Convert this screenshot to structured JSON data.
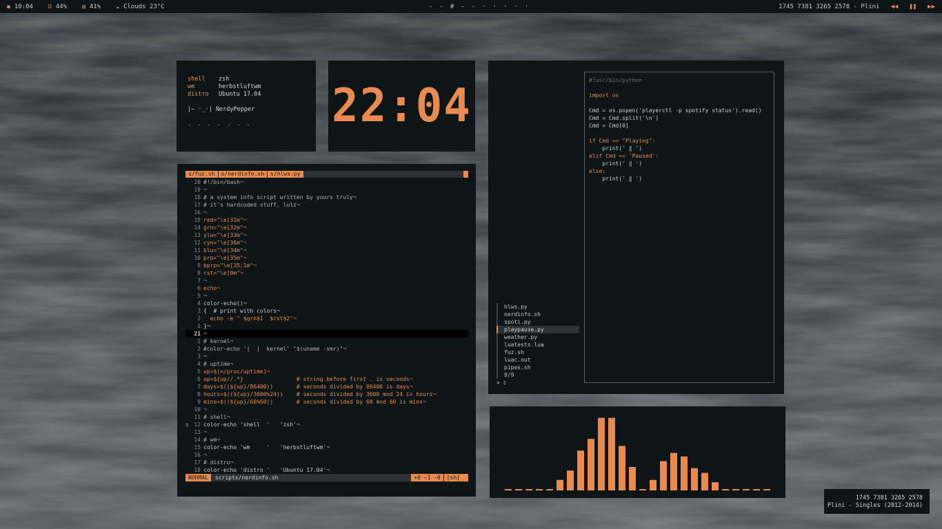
{
  "topbar": {
    "time": "10:04",
    "volume": "44%",
    "battery": "41%",
    "weather": "Clouds 23°C",
    "workspaces": [
      "-",
      "-",
      "#",
      "-",
      "-",
      "·",
      "·",
      "·",
      "·",
      "·"
    ],
    "track_numbers": "1745 7381 3265 2578",
    "artist": "Plini",
    "icons": {
      "time": "clock-icon",
      "volume": "headphones-icon",
      "battery": "battery-icon",
      "weather": "cloud-icon",
      "prev": "previous-icon",
      "pause": "pause-icon",
      "next": "next-icon"
    }
  },
  "info": {
    "rows": [
      {
        "key": "shell",
        "value": "zsh"
      },
      {
        "key": "wm",
        "value": "herbstluftwm"
      },
      {
        "key": "distro",
        "value": "Ubuntu 17.04"
      }
    ],
    "prompt": "|— ◦_◦| NerdyPepper",
    "dots": ". . . . . . ."
  },
  "clock": {
    "time": "22:04"
  },
  "editor": {
    "tabs": [
      "s/fuz.sh",
      "s/nerdinfo.sh",
      "s/hlws.py"
    ],
    "lines": [
      {
        "n": "20",
        "t": "#!/bin/bash¬"
      },
      {
        "n": "19",
        "t": "¬"
      },
      {
        "n": "18",
        "t": "# a system info script written by yours truly¬"
      },
      {
        "n": "17",
        "t": "# it's hardcoded stuff, lulz¬"
      },
      {
        "n": "16",
        "t": "¬"
      },
      {
        "n": "15",
        "t": "red=\"\\e[31m\"¬"
      },
      {
        "n": "14",
        "t": "grn=\"\\e[32m\"¬"
      },
      {
        "n": "13",
        "t": "ylw=\"\\e[33m\"¬"
      },
      {
        "n": "12",
        "t": "cyn=\"\\e[36m\"¬"
      },
      {
        "n": "11",
        "t": "blu=\"\\e[34m\"¬"
      },
      {
        "n": "10",
        "t": "prp=\"\\e[35m\"¬"
      },
      {
        "n": "9",
        "t": "bprp=\"\\e[35;1m\"¬"
      },
      {
        "n": "8",
        "t": "rst=\"\\e[0m\"¬"
      },
      {
        "n": "7",
        "t": "¬"
      },
      {
        "n": "6",
        "t": "echo¬"
      },
      {
        "n": "5",
        "t": "¬"
      },
      {
        "n": "4",
        "t": "color-echo()¬"
      },
      {
        "n": "3",
        "t": "{  # print with colors¬"
      },
      {
        "n": "2",
        "t": "  echo -e \" $grn$1  $rst$2\"¬"
      },
      {
        "n": "1",
        "t": "}¬"
      },
      {
        "n": "21",
        "t": "¬",
        "current": true
      },
      {
        "n": "1",
        "t": "# kernel¬"
      },
      {
        "n": "2",
        "t": "#color-echo '|  |  kernel' \"$(uname -smr)\"¬"
      },
      {
        "n": "3",
        "t": "¬"
      },
      {
        "n": "4",
        "t": "# uptime¬"
      },
      {
        "n": "5",
        "t": "up=$(</proc/uptime)¬"
      },
      {
        "n": "6",
        "t": "up=${up//.*}                # string before first . is seconds¬"
      },
      {
        "n": "7",
        "t": "days=$((${up}/86400))       # seconds divided by 86400 is days¬"
      },
      {
        "n": "8",
        "t": "hours=$((${up}/3600%24))    # seconds divided by 3600 mod 24 is hours¬"
      },
      {
        "n": "9",
        "t": "mins=$((${up}/60%60))       # seconds divided by 60 mod 60 is mins¬"
      },
      {
        "n": "10",
        "t": "¬"
      },
      {
        "n": "11",
        "t": "# shell¬"
      },
      {
        "n": "12",
        "t": "color-echo 'shell  '   'zsh'¬",
        "sign": "±"
      },
      {
        "n": "13",
        "t": "¬"
      },
      {
        "n": "14",
        "t": "# wm¬"
      },
      {
        "n": "15",
        "t": "color-echo 'wm     '   'herbstluftwm'¬"
      },
      {
        "n": "16",
        "t": "¬"
      },
      {
        "n": "17",
        "t": "# distro¬"
      },
      {
        "n": "18",
        "t": "color-echo 'distro '   'Ubuntu 17.04'¬"
      }
    ],
    "status": {
      "mode": "NORMAL",
      "file": "scripts/nerdinfo.sh",
      "git": "+0 ~1 -0",
      "filetype": "[sh]"
    }
  },
  "code": {
    "lines": [
      "#!usr/bin/python",
      "",
      "import os",
      "",
      "Cmd = os.popen('playerctl -p spotify status').read()",
      "Cmd = Cmd.split('\\n')",
      "Cmd = Cmd[0]",
      "",
      "if Cmd == \"Playing\":",
      "    print(' ‖ ')",
      "elif Cmd == 'Paused':",
      "    print(' ‖ ')",
      "else:",
      "    print(' ‖ ')"
    ]
  },
  "fzf": {
    "items": [
      "hlws.py",
      "nerdinfo.sh",
      "spoti.py",
      "playpause.py",
      "weather.py",
      "luatests.lua",
      "fuz.sh",
      "luac.out",
      "pipes.sh"
    ],
    "selected_index": 3,
    "count": "9/9",
    "prompt": "> ▯"
  },
  "visualizer": {
    "levels": [
      1,
      1,
      1,
      1,
      1,
      9,
      17,
      34,
      44,
      62,
      62,
      38,
      20,
      1,
      9,
      25,
      32,
      29,
      19,
      15,
      7,
      1,
      1,
      1,
      1,
      1
    ]
  },
  "nowplaying": {
    "numbers": "1745 7381 3265 2578",
    "track": "Plini - Singles (2012-2014)"
  },
  "colors": {
    "accent": "#e98b4e",
    "panel": "#0e1517",
    "text": "#c8c8c8"
  }
}
